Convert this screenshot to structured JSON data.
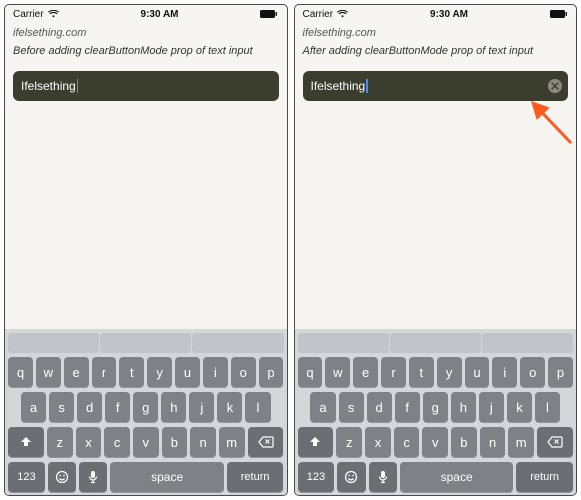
{
  "status": {
    "carrier": "Carrier",
    "time": "9:30 AM"
  },
  "panels": [
    {
      "site": "ifelsething.com",
      "caption": "Before adding clearButtonMode prop of text input",
      "input_value": "Ifelsething",
      "show_clear": false
    },
    {
      "site": "ifelsething.com",
      "caption": "After adding clearButtonMode prop of text input",
      "input_value": "Ifelsething",
      "show_clear": true
    }
  ],
  "keyboard": {
    "row1": [
      "q",
      "w",
      "e",
      "r",
      "t",
      "y",
      "u",
      "i",
      "o",
      "p"
    ],
    "row2": [
      "a",
      "s",
      "d",
      "f",
      "g",
      "h",
      "j",
      "k",
      "l"
    ],
    "row3": [
      "z",
      "x",
      "c",
      "v",
      "b",
      "n",
      "m"
    ],
    "label_123": "123",
    "label_space": "space",
    "label_return": "return"
  }
}
